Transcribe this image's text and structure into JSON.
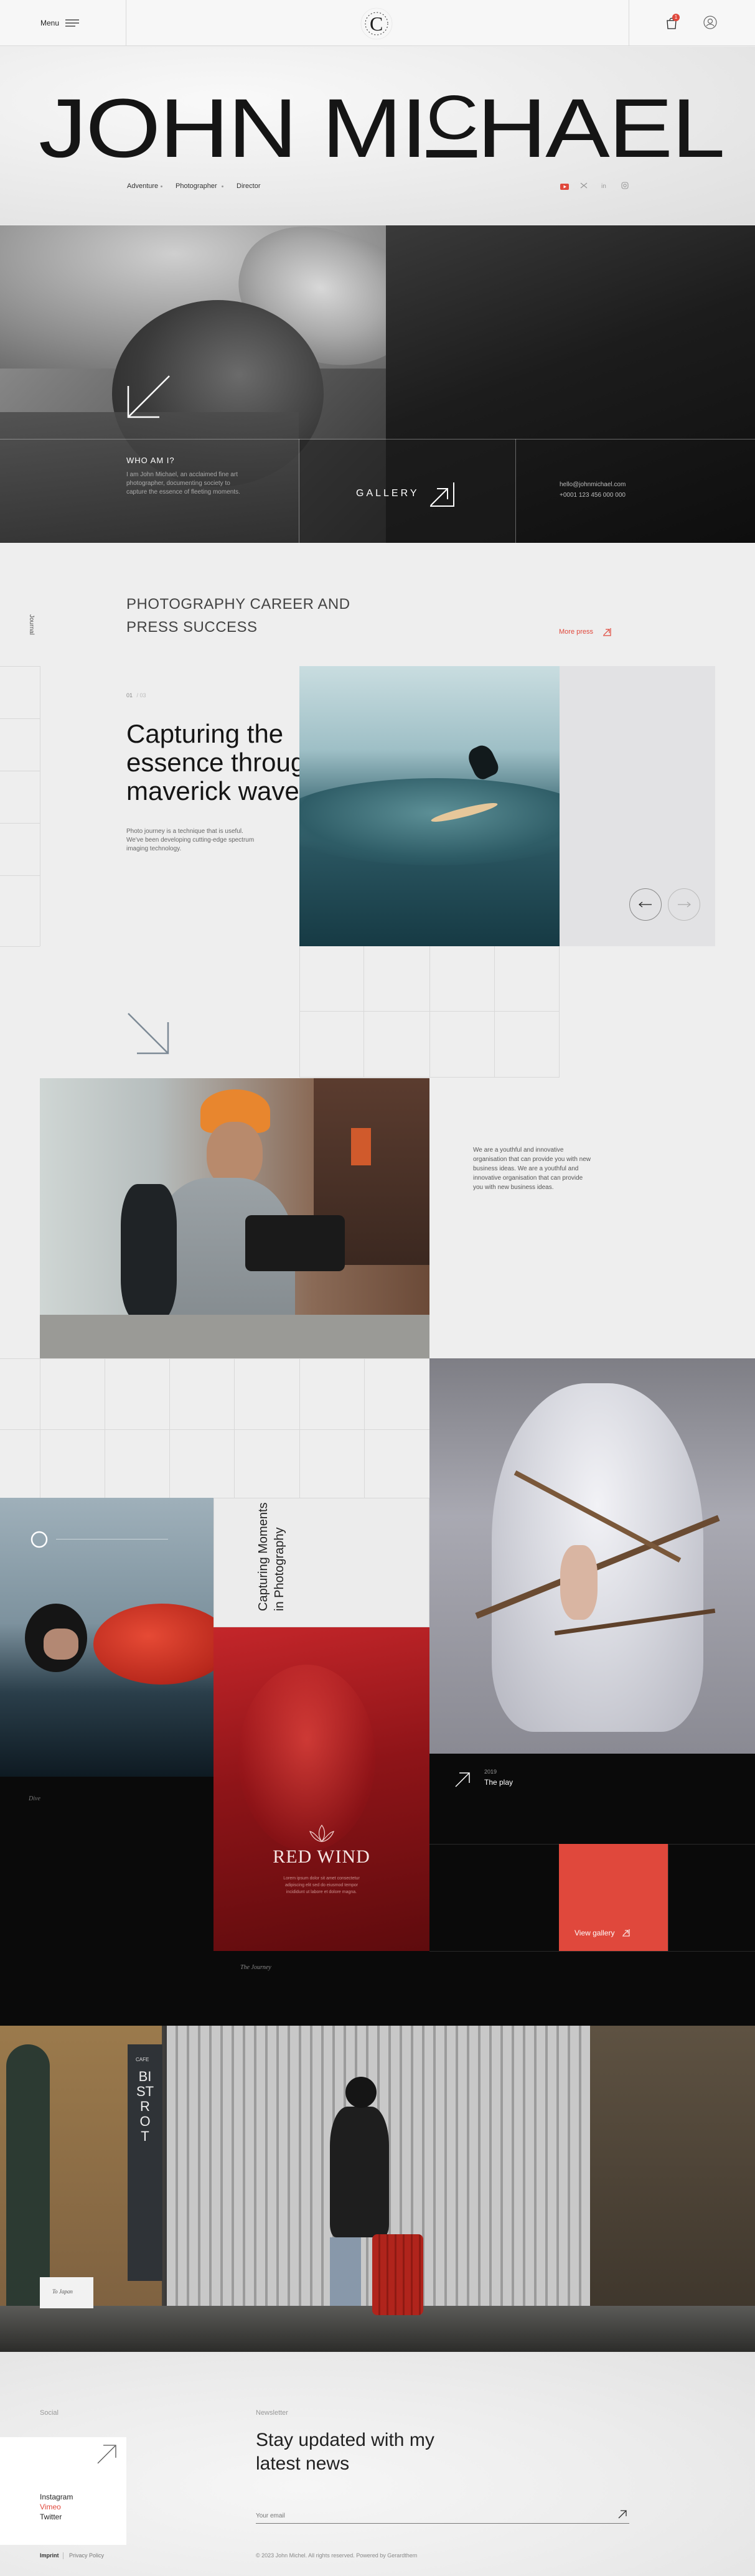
{
  "header": {
    "menu_label": "Menu",
    "logo_letter": "C",
    "logo_ring_text": "JOHNMICHAEL",
    "cart_count": "1"
  },
  "hero": {
    "name_part1": "JOHN MI",
    "name_c": "C",
    "name_part2": "HAEL",
    "roles": [
      "Adventure",
      "Photographer",
      "Director"
    ]
  },
  "intro": {
    "heading": "WHO AM I?",
    "text": "I am John Michael, an acclaimed fine art photographer, documenting society to capture the essence of fleeting moments.",
    "gallery_label": "GALLERY",
    "email": "hello@johnmichael.com",
    "phone": "+0001 123 456 000 000"
  },
  "press": {
    "side_label": "Journal",
    "heading_line1": "PHOTOGRAPHY CAREER AND",
    "heading_line2": "PRESS SUCCESS",
    "more_label": "More press",
    "counter": "01",
    "counter_total": "/ 03",
    "title_line1": "Capturing the",
    "title_line2": "essence through",
    "title_line3": "maverick waves",
    "description": "Photo journey is a technique that is useful. We've been developing cutting-edge spectrum imaging technology."
  },
  "about": {
    "text": "We are a youthful and innovative organisation that can provide you with new business ideas. We are a youthful and innovative organisation that can provide you with new business ideas."
  },
  "portfolio": {
    "vertical_title_line1": "Capturing Moments",
    "vertical_title_line2": "in Photography",
    "red_title": "RED WIND",
    "red_caption": "Lorem ipsum dolor sit amet consectetur adipiscing elit sed do eiusmod tempor incididunt ut labore et dolore magna.",
    "year": "2019",
    "play_title": "The play",
    "view_gallery": "View gallery",
    "dive_caption": "Dive",
    "sig1": "Flo",
    "sig2": "The Journey"
  },
  "street": {
    "sign_small": "CAFE",
    "sign_main": "BISTROT",
    "badge_text": "To Japan"
  },
  "footer": {
    "social_label": "Social",
    "social_links": [
      "Instagram",
      "Vimeo",
      "Twitter"
    ],
    "newsletter_label": "Newsletter",
    "newsletter_title_line1": "Stay updated with my",
    "newsletter_title_line2": "latest news",
    "email_placeholder": "Your email",
    "legal_links": [
      "Imprint",
      "Privacy Policy"
    ],
    "copyright": "© 2023 John Michel. All rights reserved. Powered by Gerardthem"
  },
  "colors": {
    "accent_red": "#e0483c",
    "dark": "#0b0b0b",
    "light_bg": "#eeeeee"
  }
}
